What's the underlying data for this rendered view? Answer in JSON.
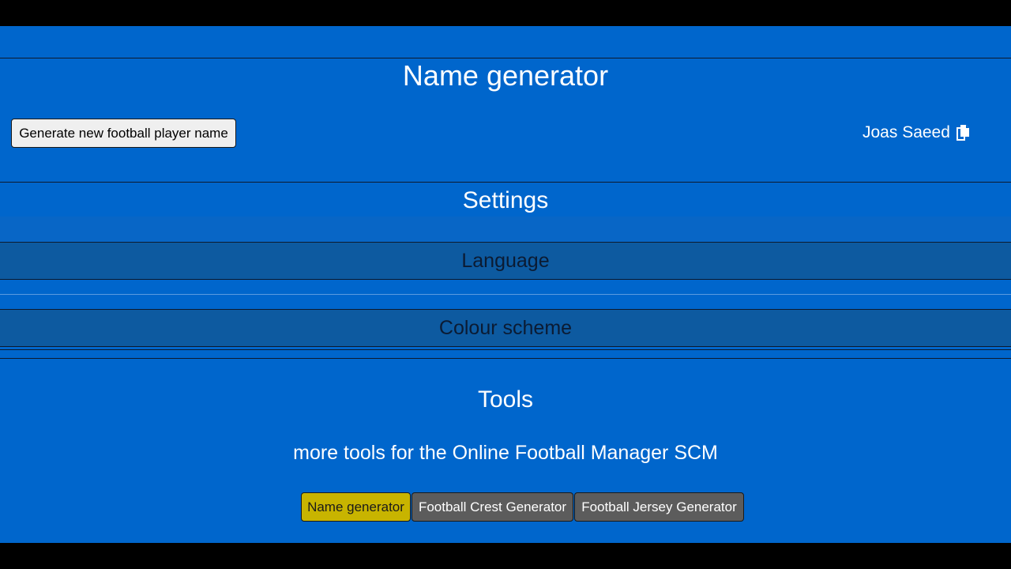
{
  "generator": {
    "title": "Name generator",
    "button_label": "Generate new football player name",
    "generated_name": "Joas Saeed",
    "copy_icon": "copy-icon"
  },
  "settings": {
    "title": "Settings",
    "sections": [
      {
        "label": "Language"
      },
      {
        "label": "Colour scheme"
      }
    ]
  },
  "tools": {
    "title": "Tools",
    "subtitle": "more tools for the Online Football Manager SCM",
    "buttons": [
      {
        "label": "Name generator",
        "active": true
      },
      {
        "label": "Football Crest Generator",
        "active": false
      },
      {
        "label": "Football Jersey Generator",
        "active": false
      }
    ]
  },
  "colors": {
    "page_background": "#0066cc",
    "letterbox": "#000000",
    "accordion_background": "#0d5aa0",
    "active_tool": "#c8b400",
    "inactive_tool": "#5c5c5c"
  }
}
